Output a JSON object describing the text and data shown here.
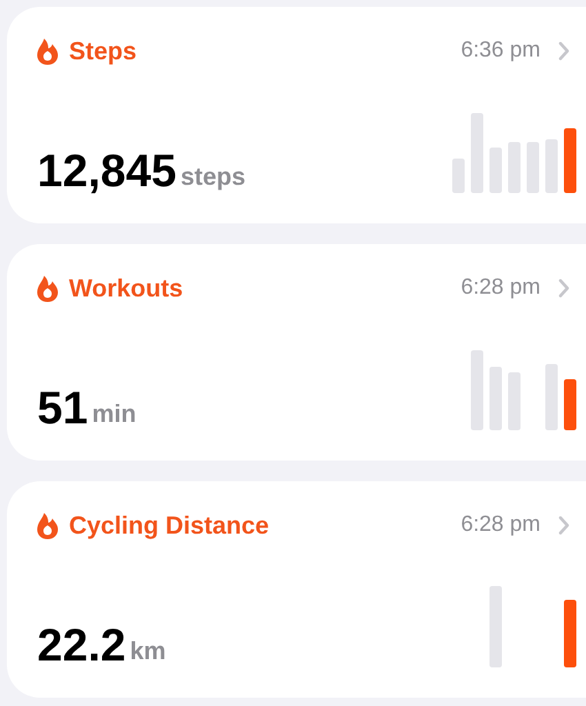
{
  "cards": [
    {
      "title": "Steps",
      "time": "6:36 pm",
      "value": "12,845",
      "unit": "steps"
    },
    {
      "title": "Workouts",
      "time": "6:28 pm",
      "value": "51",
      "unit": "min"
    },
    {
      "title": "Cycling Distance",
      "time": "6:28 pm",
      "value": "22.2",
      "unit": "km"
    }
  ]
}
